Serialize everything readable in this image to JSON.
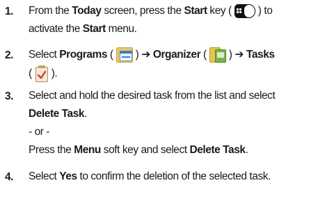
{
  "steps": [
    {
      "number": "1.",
      "l1": {
        "t1": "From the ",
        "b1": "Today",
        "t2": " screen, press the ",
        "b2": "Start",
        "t3": " key (",
        "t4": ") to"
      },
      "l2": {
        "t1": "activate the ",
        "b1": "Start",
        "t2": " menu."
      }
    },
    {
      "number": "2.",
      "l1": {
        "t1": "Select ",
        "b1": "Programs",
        "t2": " (",
        "t3": ")",
        "arrow1": "➔",
        "b2": "Organizer",
        "t4": " (",
        "t5": ")",
        "arrow2": "➔",
        "b3": "Tasks"
      },
      "l2": {
        "t1": "(",
        "t2": ")."
      }
    },
    {
      "number": "3.",
      "l1": {
        "t1": "Select and hold the desired task from the list and select"
      },
      "l2": {
        "b1": "Delete Task",
        "t1": "."
      },
      "or": "- or -",
      "l4": {
        "t1": "Press the ",
        "b1": "Menu",
        "t2": " soft key and select ",
        "b2": "Delete Task",
        "t3": "."
      }
    },
    {
      "number": "4.",
      "l1": {
        "t1": "Select ",
        "b1": "Yes",
        "t2": " to confirm the deletion of the selected task."
      }
    }
  ],
  "icons": {
    "start_key": "start-key-icon",
    "programs": "programs-folder-icon",
    "organizer": "organizer-folder-icon",
    "tasks": "tasks-clipboard-icon"
  },
  "colors": {
    "text": "#1a1a1a",
    "start_key": "#111111",
    "folder": "#e8c760",
    "organizer_green": "#7bb34a",
    "programs_blue": "#3c7bd6"
  }
}
